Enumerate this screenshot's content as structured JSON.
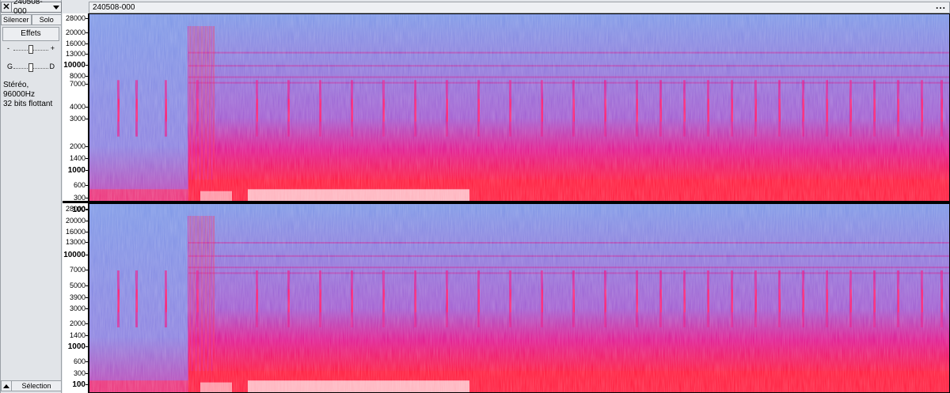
{
  "track": {
    "name": "240508-000",
    "mute_label": "Silencer",
    "solo_label": "Solo",
    "effects_label": "Effets",
    "gain_minus": "-",
    "gain_plus": "+",
    "pan_left": "G",
    "pan_right": "D",
    "format_line1": "Stéréo, 96000Hz",
    "format_line2": "32 bits flottant",
    "select_label": "Sélection"
  },
  "clip": {
    "title": "240508-000",
    "menu": "..."
  },
  "ruler": {
    "labels": [
      "28000",
      "20000",
      "16000",
      "13000",
      "10000",
      "8000",
      "7000",
      "4000",
      "3000",
      "2000",
      "1400",
      "1000",
      "600",
      "300",
      "100"
    ],
    "labels_bottom": [
      "28000",
      "20000",
      "16000",
      "13000",
      "10000",
      "7000",
      "5000",
      "3900",
      "3000",
      "2000",
      "1400",
      "1000",
      "600",
      "300",
      "100"
    ],
    "bold": [
      "10000",
      "1000",
      "100"
    ]
  },
  "colors": {
    "background_blue": "#7b96e6",
    "magenta": "#e0148c",
    "red": "#ff1638",
    "white_hot": "#ffe6ea"
  }
}
